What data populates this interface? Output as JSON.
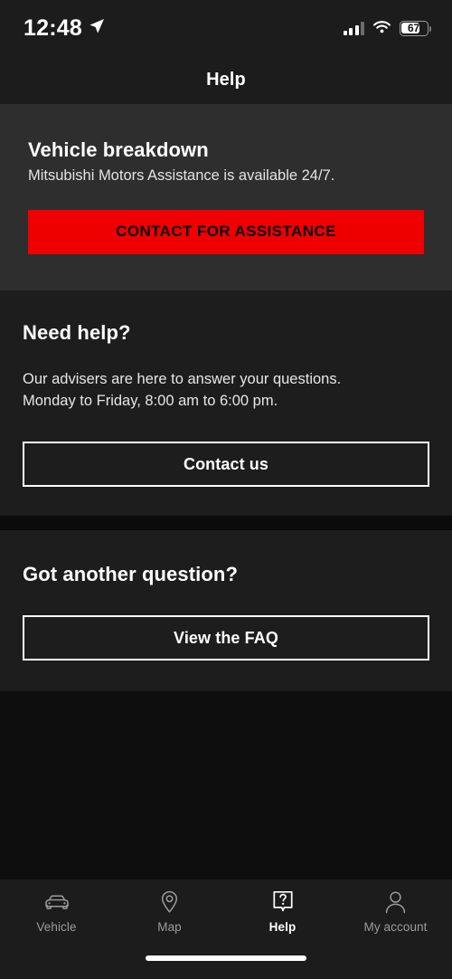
{
  "statusbar": {
    "time": "12:48",
    "location_icon": "location-arrow-icon",
    "signal_icon": "cellular-signal-icon",
    "wifi_icon": "wifi-icon",
    "battery_icon": "battery-icon",
    "battery_level": "67"
  },
  "header": {
    "title": "Help"
  },
  "breakdown": {
    "title": "Vehicle breakdown",
    "subtitle": "Mitsubishi Motors Assistance is available 24/7.",
    "cta_label": "CONTACT FOR ASSISTANCE",
    "cta_color": "#ee0000",
    "cta_text_color": "#050505",
    "background": "#2e2e2e"
  },
  "need_help": {
    "title": "Need help?",
    "body_line1": "Our advisers are here to answer your questions.",
    "body_line2": "Monday to Friday, 8:00 am to 6:00 pm.",
    "button_label": "Contact us"
  },
  "faq": {
    "title": "Got another question?",
    "button_label": "View the FAQ"
  },
  "tabbar": {
    "items": [
      {
        "label": "Vehicle",
        "icon": "car-icon",
        "active": false
      },
      {
        "label": "Map",
        "icon": "map-pin-icon",
        "active": false
      },
      {
        "label": "Help",
        "icon": "question-bubble-icon",
        "active": true
      },
      {
        "label": "My account",
        "icon": "person-icon",
        "active": false
      }
    ]
  },
  "theme": {
    "page_background": "#0e0e0e",
    "bar_background": "#1c1c1c",
    "card_background": "#1d1d1d",
    "accent": "#ee0000",
    "text_primary": "#ffffff",
    "text_muted": "#9b9b9b"
  }
}
